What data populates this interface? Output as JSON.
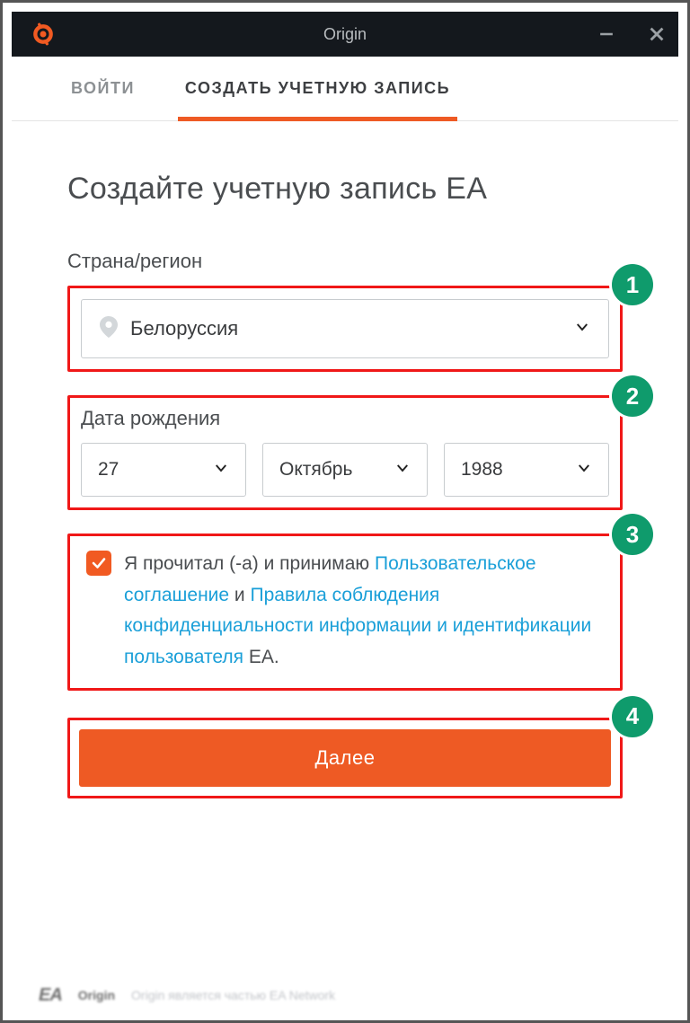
{
  "window": {
    "title": "Origin"
  },
  "tabs": {
    "login": "ВОЙТИ",
    "register": "СОЗДАТЬ УЧЕТНУЮ ЗАПИСЬ"
  },
  "page": {
    "title": "Создайте учетную запись EA"
  },
  "country": {
    "label": "Страна/регион",
    "value": "Белоруссия"
  },
  "dob": {
    "label": "Дата рождения",
    "day": "27",
    "month": "Октябрь",
    "year": "1988"
  },
  "terms": {
    "t1": "Я прочитал (-а) и принимаю ",
    "link1": "Пользовательское соглашение",
    "t2": " и ",
    "link2": "Правила соблюдения конфиденциальности информации и идентификации пользователя",
    "t3": " EA."
  },
  "next": {
    "label": "Далее"
  },
  "badges": {
    "b1": "1",
    "b2": "2",
    "b3": "3",
    "b4": "4"
  },
  "footer": {
    "ea": "EA",
    "origin": "Origin",
    "text": "Origin является частью EA Network"
  }
}
